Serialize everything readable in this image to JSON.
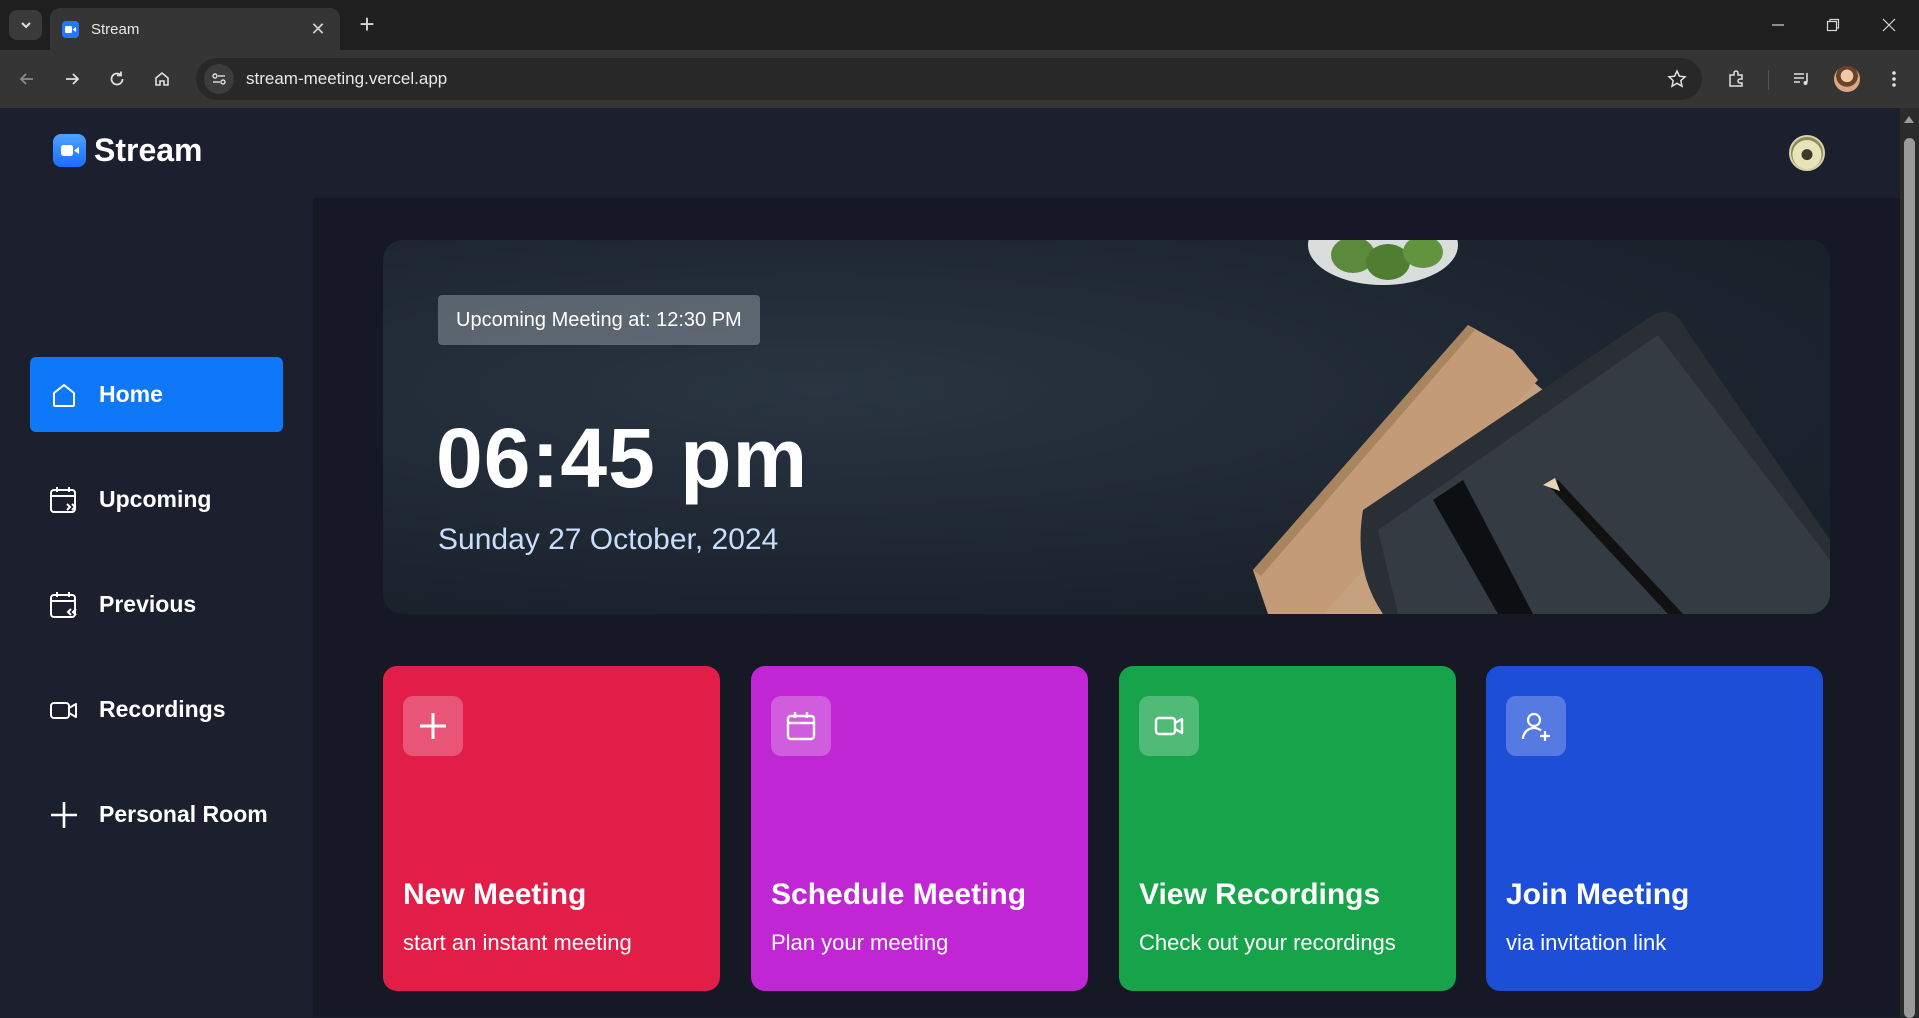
{
  "browser": {
    "tab_title": "Stream",
    "url": "stream-meeting.vercel.app"
  },
  "app": {
    "brand": "Stream",
    "sidebar": {
      "items": [
        {
          "label": "Home",
          "icon": "home-icon",
          "active": true
        },
        {
          "label": "Upcoming",
          "icon": "calendar-upcoming-icon",
          "active": false
        },
        {
          "label": "Previous",
          "icon": "calendar-previous-icon",
          "active": false
        },
        {
          "label": "Recordings",
          "icon": "video-icon",
          "active": false
        },
        {
          "label": "Personal Room",
          "icon": "plus-icon",
          "active": false
        }
      ]
    },
    "hero": {
      "upcoming": "Upcoming Meeting at: 12:30 PM",
      "time": "06:45 pm",
      "date": "Sunday 27 October, 2024"
    },
    "cards": [
      {
        "title": "New Meeting",
        "subtitle": "start an instant meeting",
        "icon": "plus-icon",
        "color": "#e11d48"
      },
      {
        "title": "Schedule Meeting",
        "subtitle": "Plan your meeting",
        "icon": "calendar-icon",
        "color": "#c026d3"
      },
      {
        "title": "View Recordings",
        "subtitle": "Check out your recordings",
        "icon": "video-icon",
        "color": "#16a34a"
      },
      {
        "title": "Join Meeting",
        "subtitle": "via invitation link",
        "icon": "add-user-icon",
        "color": "#1d4ed8"
      }
    ],
    "colors": {
      "accent": "#0e78f9",
      "background": "#161925",
      "panel": "#1c1f2e"
    }
  }
}
